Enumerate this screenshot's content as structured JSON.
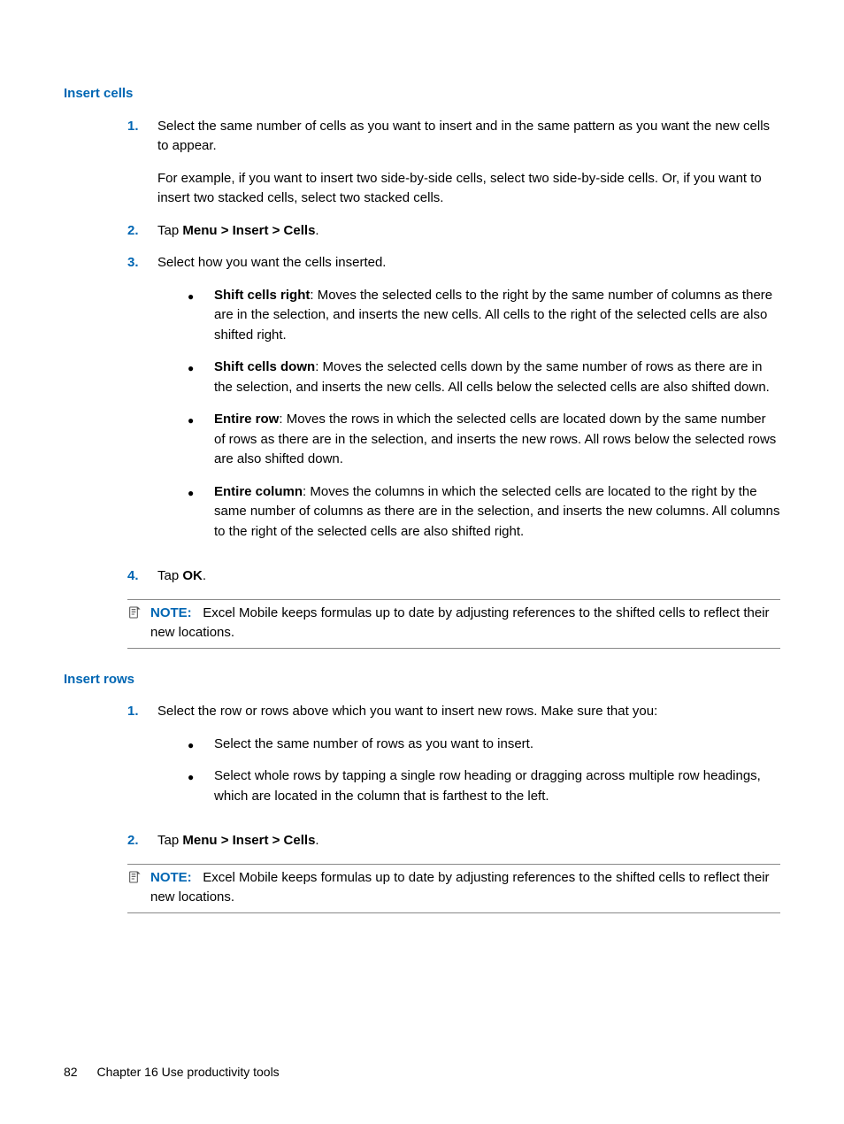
{
  "section1": {
    "heading": "Insert cells",
    "steps": [
      {
        "num": "1.",
        "p1": "Select the same number of cells as you want to insert and in the same pattern as you want the new cells to appear.",
        "p2": "For example, if you want to insert two side-by-side cells, select two side-by-side cells. Or, if you want to insert two stacked cells, select two stacked cells."
      },
      {
        "num": "2.",
        "tap_prefix": "Tap ",
        "tap_bold": "Menu > Insert > Cells",
        "tap_suffix": "."
      },
      {
        "num": "3.",
        "intro": "Select how you want the cells inserted.",
        "bullets": [
          {
            "bold": "Shift cells right",
            "rest": ": Moves the selected cells to the right by the same number of columns as there are in the selection, and inserts the new cells. All cells to the right of the selected cells are also shifted right."
          },
          {
            "bold": "Shift cells down",
            "rest": ": Moves the selected cells down by the same number of rows as there are in the selection, and inserts the new cells. All cells below the selected cells are also shifted down."
          },
          {
            "bold": "Entire row",
            "rest": ": Moves the rows in which the selected cells are located down by the same number of rows as there are in the selection, and inserts the new rows. All rows below the selected rows are also shifted down."
          },
          {
            "bold": "Entire column",
            "rest": ": Moves the columns in which the selected cells are located to the right by the same number of columns as there are in the selection, and inserts the new columns. All columns to the right of the selected cells are also shifted right."
          }
        ]
      },
      {
        "num": "4.",
        "tap_prefix": "Tap ",
        "tap_bold": "OK",
        "tap_suffix": "."
      }
    ],
    "note": {
      "label": "NOTE:",
      "text": "Excel Mobile keeps formulas up to date by adjusting references to the shifted cells to reflect their new locations."
    }
  },
  "section2": {
    "heading": "Insert rows",
    "steps": [
      {
        "num": "1.",
        "intro": "Select the row or rows above which you want to insert new rows. Make sure that you:",
        "bullets": [
          {
            "text": "Select the same number of rows as you want to insert."
          },
          {
            "text": "Select whole rows by tapping a single row heading or dragging across multiple row headings, which are located in the column that is farthest to the left."
          }
        ]
      },
      {
        "num": "2.",
        "tap_prefix": "Tap ",
        "tap_bold": "Menu > Insert > Cells",
        "tap_suffix": "."
      }
    ],
    "note": {
      "label": "NOTE:",
      "text": "Excel Mobile keeps formulas up to date by adjusting references to the shifted cells to reflect their new locations."
    }
  },
  "footer": {
    "page": "82",
    "chapter": "Chapter 16   Use productivity tools"
  }
}
